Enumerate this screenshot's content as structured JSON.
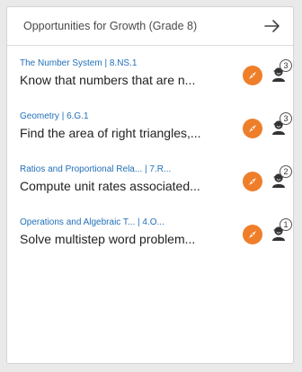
{
  "card": {
    "title": "Opportunities for Growth (Grade 8)"
  },
  "items": [
    {
      "domain": "The Number System",
      "standard": "8.NS.1",
      "description": "Know that numbers that are n...",
      "student_count": "3"
    },
    {
      "domain": "Geometry",
      "standard": "6.G.1",
      "description": "Find the area of right triangles,...",
      "student_count": "3"
    },
    {
      "domain": "Ratios and Proportional Rela...",
      "standard": "7.R...",
      "description": "Compute unit rates associated...",
      "student_count": "2"
    },
    {
      "domain": "Operations and Algebraic T...",
      "standard": "4.O...",
      "description": "Solve multistep word problem...",
      "student_count": "1"
    }
  ],
  "icons": {
    "header_action": "arrow-right-icon",
    "explore": "compass-icon",
    "students": "student-group-icon"
  },
  "colors": {
    "link": "#2370b9",
    "accent": "#ef7e2a",
    "text": "#222222"
  }
}
